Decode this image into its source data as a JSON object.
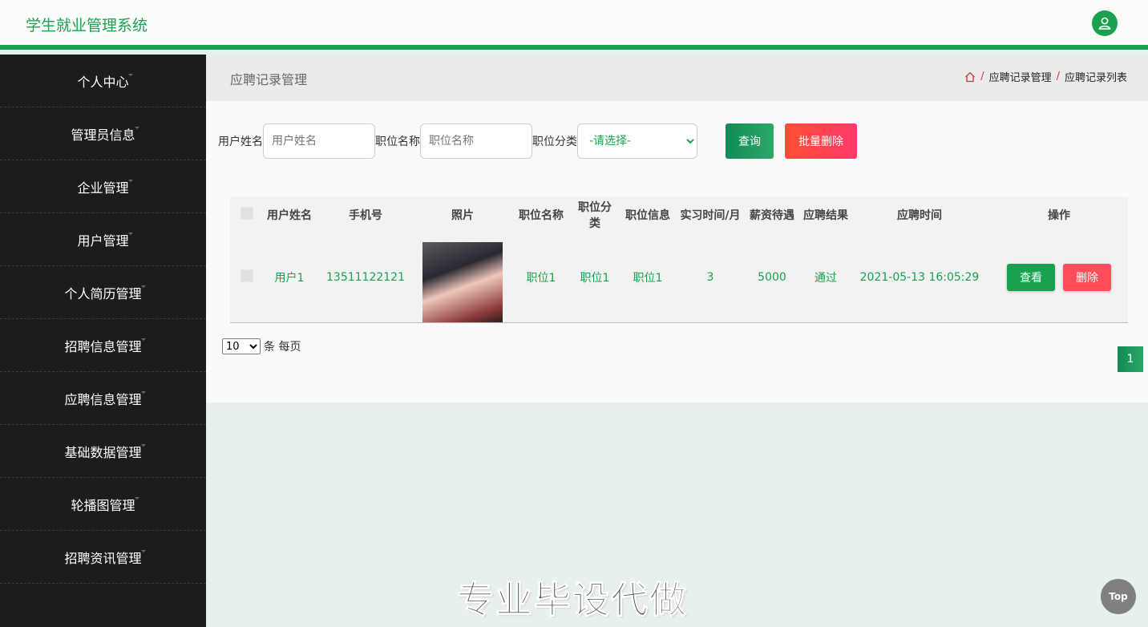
{
  "app": {
    "title": "学生就业管理系统"
  },
  "header": {
    "user_icon": "user-icon"
  },
  "sidebar": {
    "items": [
      {
        "label": "个人中心"
      },
      {
        "label": "管理员信息"
      },
      {
        "label": "企业管理"
      },
      {
        "label": "用户管理"
      },
      {
        "label": "个人简历管理"
      },
      {
        "label": "招聘信息管理"
      },
      {
        "label": "应聘信息管理"
      },
      {
        "label": "基础数据管理"
      },
      {
        "label": "轮播图管理"
      },
      {
        "label": "招聘资讯管理"
      }
    ]
  },
  "page": {
    "title": "应聘记录管理",
    "breadcrumb": [
      "应聘记录管理",
      "应聘记录列表"
    ],
    "breadcrumb_sep": "/"
  },
  "search": {
    "username_label": "用户姓名",
    "username_placeholder": "用户姓名",
    "position_label": "职位名称",
    "position_placeholder": "职位名称",
    "category_label": "职位分类",
    "category_selected": "-请选择-",
    "query_button": "查询",
    "batch_delete_button": "批量删除"
  },
  "table": {
    "columns": [
      "用户姓名",
      "手机号",
      "照片",
      "职位名称",
      "职位分类",
      "职位信息",
      "实习时间/月",
      "薪资待遇",
      "应聘结果",
      "应聘时间",
      "操作"
    ],
    "rows": [
      {
        "username": "用户1",
        "phone": "13511122121",
        "position_name": "职位1",
        "position_category": "职位1",
        "position_info": "职位1",
        "internship_months": "3",
        "salary": "5000",
        "result": "通过",
        "apply_time": "2021-05-13 16:05:29",
        "view_button": "查看",
        "delete_button": "删除"
      }
    ]
  },
  "pagination": {
    "page_size": "10",
    "page_size_suffix": "条 每页",
    "current_page": "1"
  },
  "watermark": "专业毕设代做",
  "top_button": "Top",
  "colors": {
    "brand": "#1aa150",
    "danger": "#ff4e5a",
    "sidebar_bg": "#1b1d1c"
  }
}
